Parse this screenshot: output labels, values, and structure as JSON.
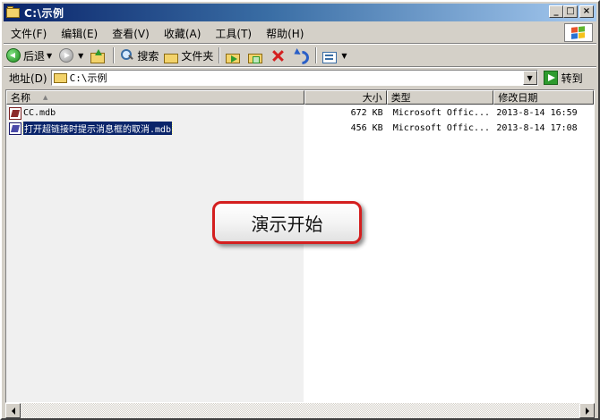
{
  "window": {
    "title": "C:\\示例",
    "buttons": {
      "minimize": "_",
      "maximize": "□",
      "close": "×"
    }
  },
  "menu": {
    "items": [
      "文件(F)",
      "编辑(E)",
      "查看(V)",
      "收藏(A)",
      "工具(T)",
      "帮助(H)"
    ]
  },
  "toolbar": {
    "back_label": "后退",
    "search_label": "搜索",
    "folders_label": "文件夹"
  },
  "address": {
    "label": "地址(D)",
    "value": "C:\\示例",
    "go_label": "转到"
  },
  "columns": {
    "name": "名称",
    "size": "大小",
    "type": "类型",
    "modified": "修改日期"
  },
  "files": [
    {
      "name": "CC.mdb",
      "size": "672 KB",
      "type": "Microsoft Offic...",
      "modified": "2013-8-14 16:59",
      "selected": false
    },
    {
      "name": "打开超链接时提示消息框的取消.mdb",
      "size": "456 KB",
      "type": "Microsoft Offic...",
      "modified": "2013-8-14 17:08",
      "selected": true
    }
  ],
  "overlay": {
    "demo_button_label": "演示开始",
    "accent_color": "#d41f1f"
  },
  "icons": {
    "title": "folder-icon",
    "back": "back-arrow-icon",
    "forward": "forward-arrow-icon",
    "up": "up-folder-icon",
    "search": "search-icon",
    "folders": "folders-icon",
    "move": "move-to-icon",
    "copy": "copy-to-icon",
    "delete": "delete-icon",
    "undo": "undo-icon",
    "views": "views-icon",
    "go": "go-arrow-icon",
    "file": "access-database-icon"
  }
}
